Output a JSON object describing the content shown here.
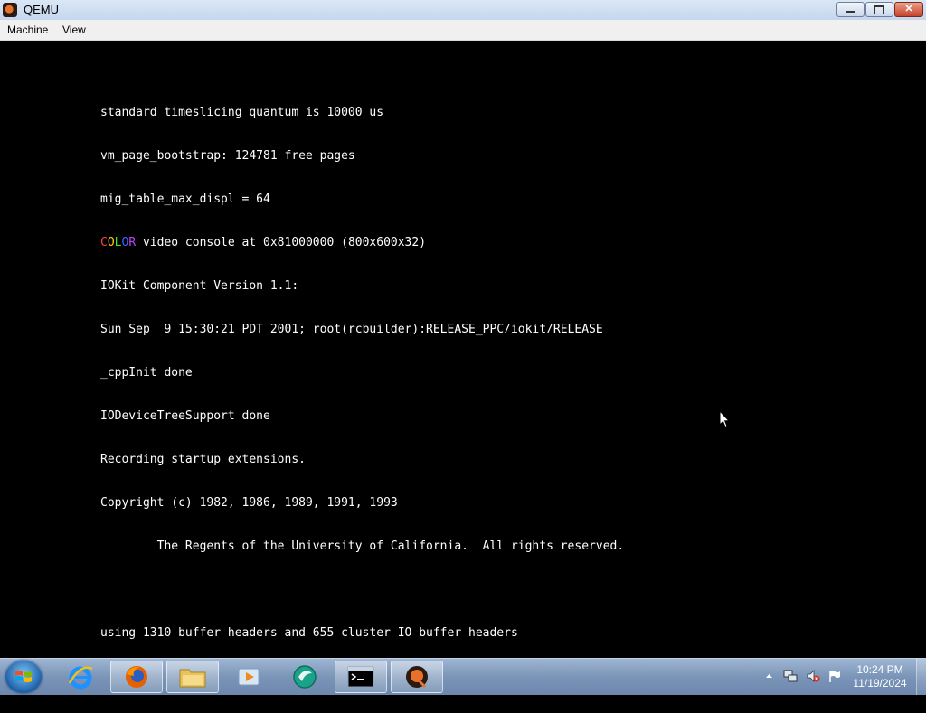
{
  "window": {
    "title": "QEMU",
    "close_symbol": "✕"
  },
  "menu": {
    "items": [
      "Machine",
      "View"
    ]
  },
  "console": {
    "lines": [
      "standard timeslicing quantum is 10000 us",
      "vm_page_bootstrap: 124781 free pages",
      "mig_table_max_displ = 64",
      "COLOR video console at 0x81000000 (800x600x32)",
      "IOKit Component Version 1.1:",
      "Sun Sep  9 15:30:21 PDT 2001; root(rcbuilder):RELEASE_PPC/iokit/RELEASE",
      "_cppInit done",
      "IODeviceTreeSupport done",
      "Recording startup extensions.",
      "Copyright (c) 1982, 1986, 1989, 1991, 1993",
      "        The Regents of the University of California.  All rights reserved.",
      "",
      "using 1310 buffer headers and 655 cluster IO buffer headers"
    ],
    "color_word_letters": [
      "C",
      "O",
      "L",
      "O",
      "R"
    ],
    "color_word_colors": [
      "#ff4040",
      "#ffd000",
      "#40e040",
      "#4060ff",
      "#c040ff"
    ],
    "color_line_rest": " video console at 0x81000000 (800x600x32)"
  },
  "taskbar": {
    "items": [
      {
        "name": "internet-explorer-icon"
      },
      {
        "name": "firefox-icon"
      },
      {
        "name": "file-explorer-icon"
      },
      {
        "name": "media-player-icon"
      },
      {
        "name": "browser-globe-icon"
      },
      {
        "name": "command-prompt-icon"
      },
      {
        "name": "qemu-icon"
      }
    ],
    "clock": {
      "time": "10:24 PM",
      "date": "11/19/2024"
    }
  },
  "colors": {
    "console_bg": "#000000",
    "console_text": "#ffffff",
    "taskbar": "#7a95b8"
  }
}
